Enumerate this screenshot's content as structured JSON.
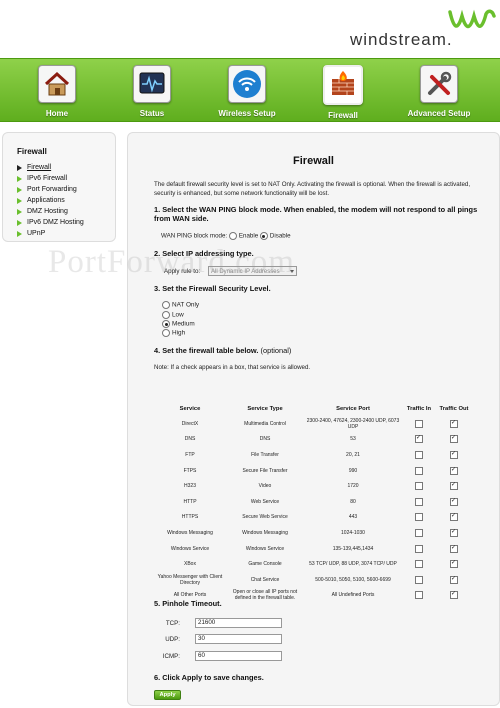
{
  "brand": {
    "name": "windstream."
  },
  "nav": [
    {
      "label": "Home",
      "icon": "home-icon"
    },
    {
      "label": "Status",
      "icon": "status-monitor-icon"
    },
    {
      "label": "Wireless Setup",
      "icon": "wireless-icon"
    },
    {
      "label": "Firewall",
      "icon": "firewall-icon",
      "active": true
    },
    {
      "label": "Advanced Setup",
      "icon": "tools-icon"
    }
  ],
  "sidebar": {
    "title": "Firewall",
    "items": [
      {
        "label": "Firewall",
        "active": true
      },
      {
        "label": "IPv6 Firewall"
      },
      {
        "label": "Port Forwarding"
      },
      {
        "label": "Applications"
      },
      {
        "label": "DMZ Hosting"
      },
      {
        "label": "IPv6 DMZ Hosting"
      },
      {
        "label": "UPnP"
      }
    ]
  },
  "main": {
    "title": "Firewall",
    "intro": "The default firewall security level is set to NAT Only. Activating the firewall is optional. When the firewall is activated, security is enhanced, but some network functionality will be lost.",
    "step1": "1. Select the WAN PING block mode. When enabled, the modem will not respond to all pings from WAN side.",
    "ping_label": "WAN PING block mode:",
    "ping_enable": "Enable",
    "ping_disable": "Disable",
    "step2": "2. Select IP addressing type.",
    "apply_rule_label": "Apply rule to:",
    "apply_rule_value": "All Dynamic IP Addresses",
    "step3": "3. Set the Firewall Security Level.",
    "levels": [
      "NAT Only",
      "Low",
      "Medium",
      "High"
    ],
    "selected_level": "Medium",
    "step4": "4. Set the firewall table below.",
    "step4_opt": "(optional)",
    "note": "Note: If a check appears in a box, that service is allowed.",
    "table": {
      "headers": {
        "service": "Service",
        "type": "Service Type",
        "port": "Service Port",
        "in": "Traffic In",
        "out": "Traffic Out"
      },
      "rows": [
        {
          "service": "DirectX",
          "type": "Multimedia Control",
          "port": "2300-2400, 47624, 2300-2400 UDP, 6073 UDP",
          "in": false,
          "out": true
        },
        {
          "service": "DNS",
          "type": "DNS",
          "port": "53",
          "in": true,
          "out": true
        },
        {
          "service": "FTP",
          "type": "File Transfer",
          "port": "20, 21",
          "in": false,
          "out": true
        },
        {
          "service": "FTPS",
          "type": "Secure File Transfer",
          "port": "990",
          "in": false,
          "out": true
        },
        {
          "service": "H323",
          "type": "Video",
          "port": "1720",
          "in": false,
          "out": true
        },
        {
          "service": "HTTP",
          "type": "Web Service",
          "port": "80",
          "in": false,
          "out": true
        },
        {
          "service": "HTTPS",
          "type": "Secure Web Service",
          "port": "443",
          "in": false,
          "out": true
        },
        {
          "service": "Windows Messaging",
          "type": "Windows Messaging",
          "port": "1024-1030",
          "in": false,
          "out": true
        },
        {
          "service": "Windows Service",
          "type": "Windows Service",
          "port": "135-139,445,1434",
          "in": false,
          "out": true
        },
        {
          "service": "XBox",
          "type": "Game Console",
          "port": "53 TCP/ UDP, 88 UDP, 3074 TCP/ UDP",
          "in": false,
          "out": true
        },
        {
          "service": "Yahoo Messenger with Client Directory",
          "type": "Chat Service",
          "port": "500-5010, 5050, 5100, 5600-6699",
          "in": false,
          "out": true
        },
        {
          "service": "All Other Ports",
          "type": "Open or close all IP ports not defined in the firewall table.",
          "port": "All Undefined Ports",
          "in": false,
          "out": true
        }
      ]
    },
    "step5": "5. Pinhole Timeout.",
    "tcp_label": "TCP:",
    "tcp_value": "21600",
    "udp_label": "UDP:",
    "udp_value": "30",
    "icmp_label": "ICMP:",
    "icmp_value": "60",
    "step6": "6. Click Apply to save changes.",
    "apply_button": "Apply"
  },
  "watermark": "PortForward.com"
}
